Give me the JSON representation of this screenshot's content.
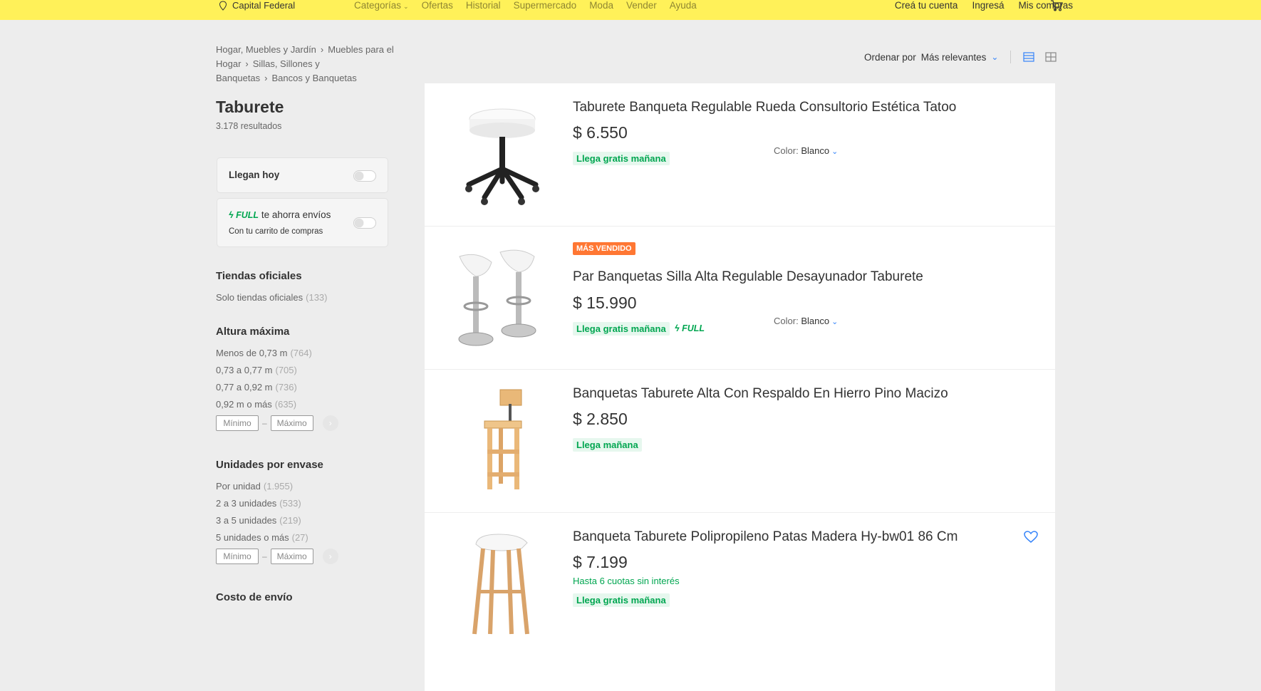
{
  "header": {
    "location": "Capital Federal",
    "nav": [
      "Categorías",
      "Ofertas",
      "Historial",
      "Supermercado",
      "Moda",
      "Vender",
      "Ayuda"
    ],
    "user": [
      "Creá tu cuenta",
      "Ingresá",
      "Mis compras"
    ]
  },
  "breadcrumbs": [
    "Hogar, Muebles y Jardín",
    "Muebles para el Hogar",
    "Sillas, Sillones y Banquetas",
    "Bancos y Banquetas"
  ],
  "page": {
    "title": "Taburete",
    "results_count": "3.178 resultados"
  },
  "filters": {
    "llegan_hoy": "Llegan hoy",
    "full_word": "FULL",
    "full_label": "te ahorra envíos",
    "full_sub": "Con tu carrito de compras",
    "groups": [
      {
        "title": "Tiendas oficiales",
        "items": [
          {
            "label": "Solo tiendas oficiales",
            "qty": "(133)"
          }
        ]
      },
      {
        "title": "Altura máxima",
        "items": [
          {
            "label": "Menos de 0,73 m",
            "qty": "(764)"
          },
          {
            "label": "0,73 a 0,77 m",
            "qty": "(705)"
          },
          {
            "label": "0,77 a 0,92 m",
            "qty": "(736)"
          },
          {
            "label": "0,92 m o más",
            "qty": "(635)"
          }
        ],
        "min": "Mínimo",
        "max": "Máximo"
      },
      {
        "title": "Unidades por envase",
        "items": [
          {
            "label": "Por unidad",
            "qty": "(1.955)"
          },
          {
            "label": "2 a 3 unidades",
            "qty": "(533)"
          },
          {
            "label": "3 a 5 unidades",
            "qty": "(219)"
          },
          {
            "label": "5 unidades o más",
            "qty": "(27)"
          }
        ],
        "min": "Mínimo",
        "max": "Máximo"
      },
      {
        "title": "Costo de envío",
        "items": []
      }
    ]
  },
  "sort": {
    "label": "Ordenar por",
    "value": "Más relevantes"
  },
  "products": [
    {
      "title": "Taburete Banqueta Regulable Rueda Consultorio Estética Tatoo",
      "price": "$ 6.550",
      "shipping": "Llega gratis mañana",
      "variant_label": "Color:",
      "variant_value": "Blanco"
    },
    {
      "badge": "MÁS VENDIDO",
      "title": "Par Banquetas Silla Alta Regulable Desayunador Taburete",
      "price": "$ 15.990",
      "shipping": "Llega gratis mañana",
      "full": "FULL",
      "variant_label": "Color:",
      "variant_value": "Blanco"
    },
    {
      "title": "Banquetas Taburete Alta Con Respaldo En Hierro Pino Macizo",
      "price": "$ 2.850",
      "shipping": "Llega mañana"
    },
    {
      "title": "Banqueta Taburete Polipropileno Patas Madera Hy-bw01 86 Cm",
      "price": "$ 7.199",
      "installments": "Hasta 6 cuotas sin interés",
      "shipping": "Llega gratis mañana"
    }
  ],
  "colors": {
    "header_bg": "#fff159",
    "accent_blue": "#3483fa",
    "green": "#00a650",
    "badge_orange": "#ff7733"
  }
}
